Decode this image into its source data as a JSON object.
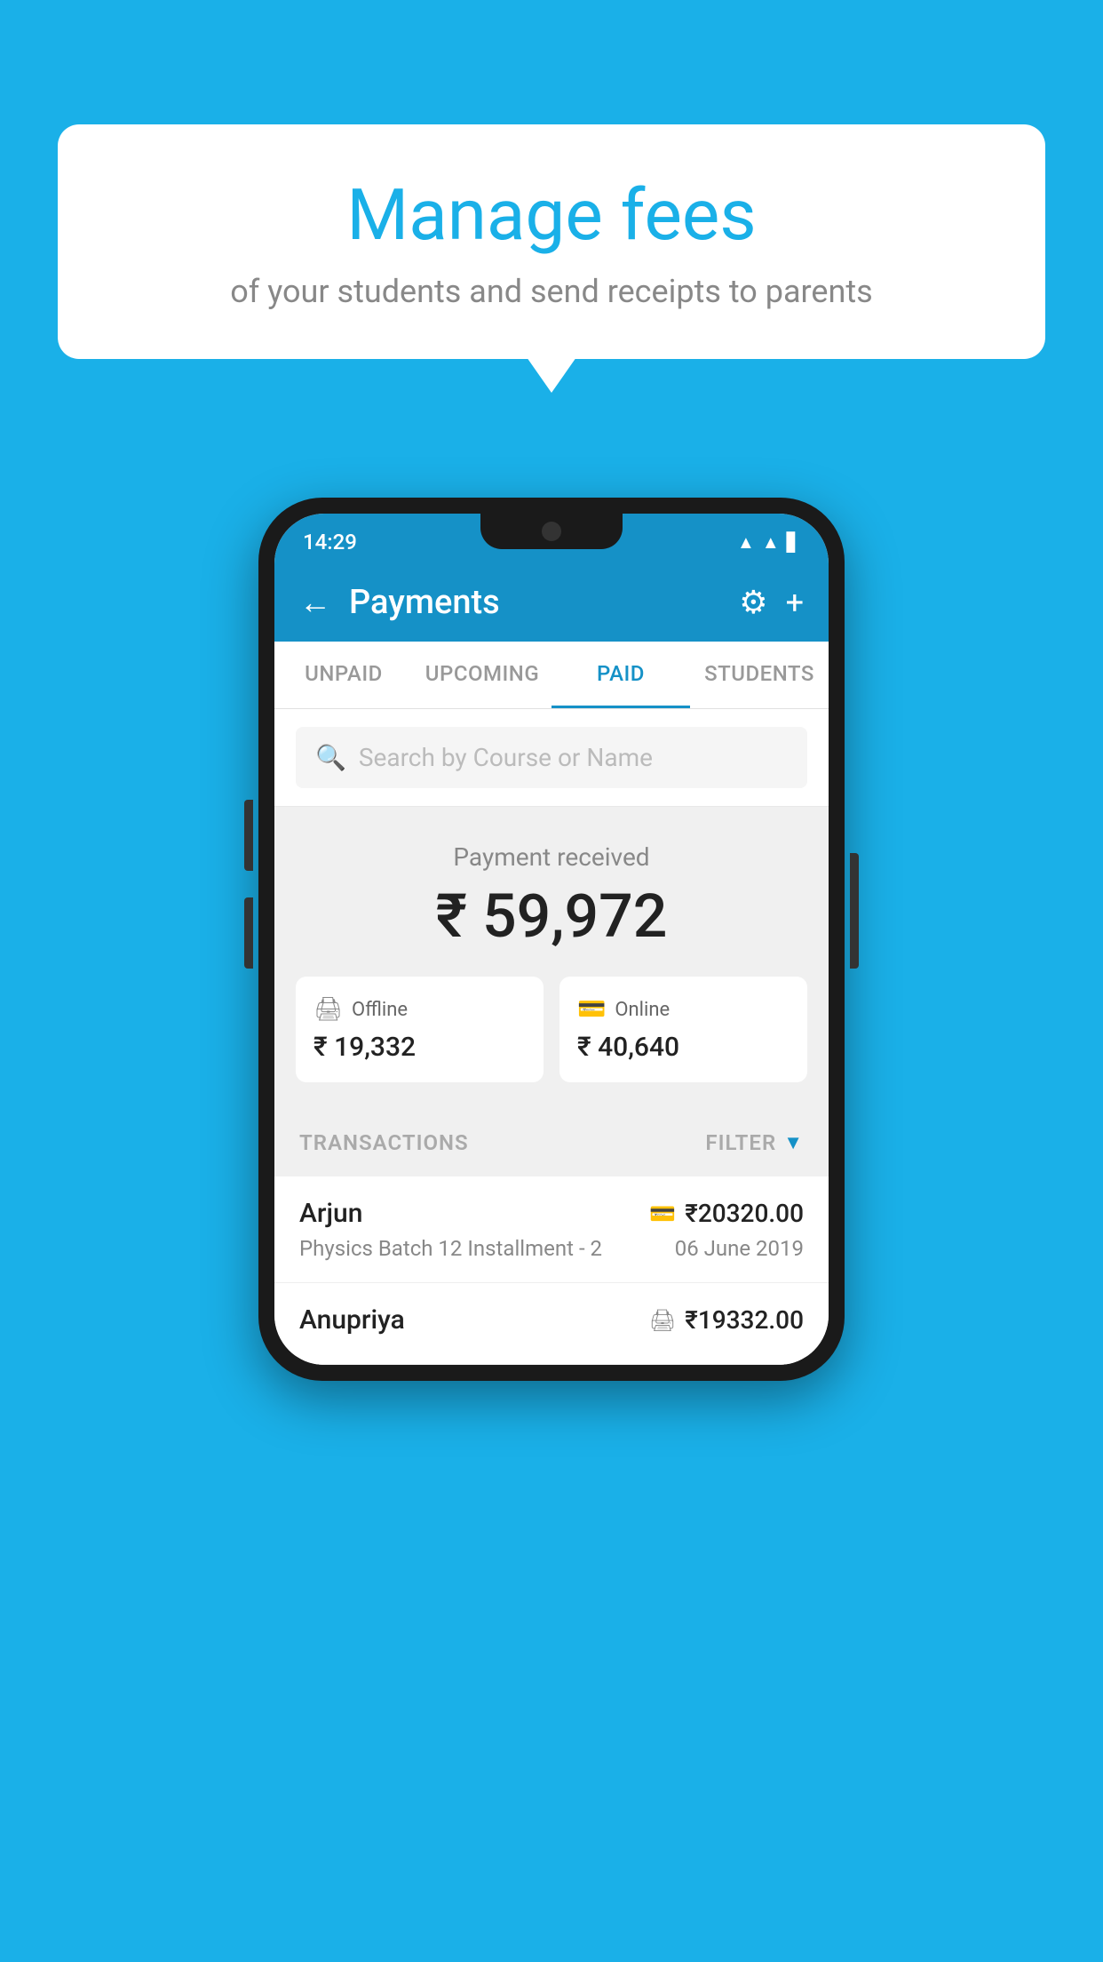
{
  "background_color": "#1ab0e8",
  "bubble": {
    "title": "Manage fees",
    "subtitle": "of your students and send receipts to parents"
  },
  "status_bar": {
    "time": "14:29",
    "icons": [
      "wifi",
      "signal",
      "battery"
    ]
  },
  "header": {
    "title": "Payments",
    "back_label": "←",
    "settings_label": "⚙",
    "add_label": "+"
  },
  "tabs": [
    {
      "label": "UNPAID",
      "active": false
    },
    {
      "label": "UPCOMING",
      "active": false
    },
    {
      "label": "PAID",
      "active": true
    },
    {
      "label": "STUDENTS",
      "active": false
    }
  ],
  "search": {
    "placeholder": "Search by Course or Name"
  },
  "payment": {
    "label": "Payment received",
    "total": "₹ 59,972",
    "offline_label": "Offline",
    "offline_amount": "₹ 19,332",
    "online_label": "Online",
    "online_amount": "₹ 40,640"
  },
  "transactions_label": "TRANSACTIONS",
  "filter_label": "FILTER",
  "transactions": [
    {
      "name": "Arjun",
      "course": "Physics Batch 12 Installment - 2",
      "amount": "₹20320.00",
      "date": "06 June 2019",
      "type": "online"
    },
    {
      "name": "Anupriya",
      "course": "",
      "amount": "₹19332.00",
      "date": "",
      "type": "offline"
    }
  ]
}
